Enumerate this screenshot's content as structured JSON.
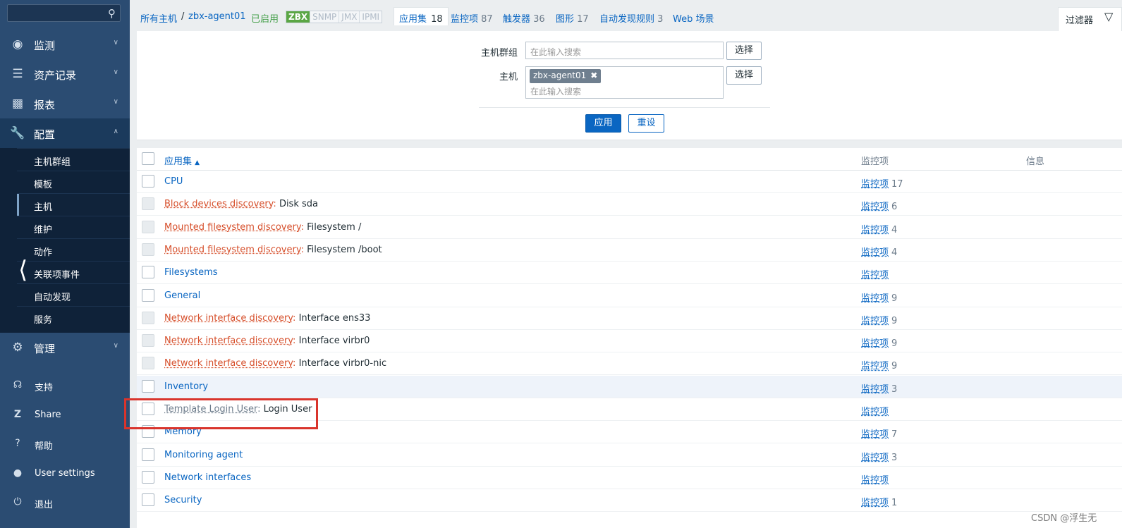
{
  "sidebar": {
    "search": {
      "placeholder": ""
    },
    "sections": [
      {
        "label": "监测",
        "icon": "eye-icon"
      },
      {
        "label": "资产记录",
        "icon": "list-icon"
      },
      {
        "label": "报表",
        "icon": "bar-chart-icon"
      },
      {
        "label": "配置",
        "icon": "wrench-icon"
      },
      {
        "label": "管理",
        "icon": "gear-icon"
      }
    ],
    "config_items": [
      "主机群组",
      "模板",
      "主机",
      "维护",
      "动作",
      "关联项事件",
      "自动发现",
      "服务"
    ],
    "bottom_items": [
      {
        "label": "支持",
        "icon": "headset-icon"
      },
      {
        "label": "Share",
        "icon": "z-icon"
      },
      {
        "label": "帮助",
        "icon": "question-icon"
      },
      {
        "label": "User settings",
        "icon": "user-icon"
      },
      {
        "label": "退出",
        "icon": "power-icon"
      }
    ]
  },
  "header": {
    "breadcrumb_all": "所有主机",
    "breadcrumb_sep": "/",
    "breadcrumb_host": "zbx-agent01",
    "status": "已启用",
    "protocols": [
      "ZBX",
      "SNMP",
      "JMX",
      "IPMI"
    ],
    "tabs": [
      {
        "label": "应用集",
        "count": "18"
      },
      {
        "label": "监控项",
        "count": "87"
      },
      {
        "label": "触发器",
        "count": "36"
      },
      {
        "label": "图形",
        "count": "17"
      },
      {
        "label": "自动发现规则",
        "count": "3"
      },
      {
        "label": "Web 场景",
        "count": ""
      }
    ],
    "filter_label": "过滤器"
  },
  "filter": {
    "host_group_label": "主机群组",
    "host_label": "主机",
    "placeholder": "在此输入搜索",
    "select_label": "选择",
    "host_tag": "zbx-agent01",
    "apply": "应用",
    "reset": "重设"
  },
  "table": {
    "headers": {
      "name": "应用集",
      "sort_arrow": "▲",
      "items": "监控项",
      "info": "信息"
    },
    "rows": [
      {
        "template": "",
        "name": "CPU",
        "items_label": "监控项",
        "items_count": "17"
      },
      {
        "template": "Block devices discovery",
        "name": "Disk sda",
        "items_label": "监控项",
        "items_count": "6"
      },
      {
        "template": "Mounted filesystem discovery",
        "name": "Filesystem /",
        "items_label": "监控项",
        "items_count": "4"
      },
      {
        "template": "Mounted filesystem discovery",
        "name": "Filesystem /boot",
        "items_label": "监控项",
        "items_count": "4"
      },
      {
        "template": "",
        "name": "Filesystems",
        "items_label": "监控项",
        "items_count": ""
      },
      {
        "template": "",
        "name": "General",
        "items_label": "监控项",
        "items_count": "9"
      },
      {
        "template": "Network interface discovery",
        "name": "Interface ens33",
        "items_label": "监控项",
        "items_count": "9"
      },
      {
        "template": "Network interface discovery",
        "name": "Interface virbr0",
        "items_label": "监控项",
        "items_count": "9"
      },
      {
        "template": "Network interface discovery",
        "name": "Interface virbr0-nic",
        "items_label": "监控项",
        "items_count": "9"
      },
      {
        "template": "",
        "name": "Inventory",
        "items_label": "监控项",
        "items_count": "3"
      },
      {
        "template": "Template Login User",
        "name": "Login User",
        "items_label": "监控项",
        "items_count": ""
      },
      {
        "template": "",
        "name": "Memory",
        "items_label": "监控项",
        "items_count": "7"
      },
      {
        "template": "",
        "name": "Monitoring agent",
        "items_label": "监控项",
        "items_count": "3"
      },
      {
        "template": "",
        "name": "Network interfaces",
        "items_label": "监控项",
        "items_count": ""
      },
      {
        "template": "",
        "name": "Security",
        "items_label": "监控项",
        "items_count": "1"
      }
    ]
  },
  "watermark": "CSDN @浮生无",
  "colors": {
    "sidebar": "#2b4c72",
    "link": "#0a66c2",
    "template_link": "#d64e2a",
    "highlight_box": "#d9342c",
    "enabled": "#429e47"
  }
}
